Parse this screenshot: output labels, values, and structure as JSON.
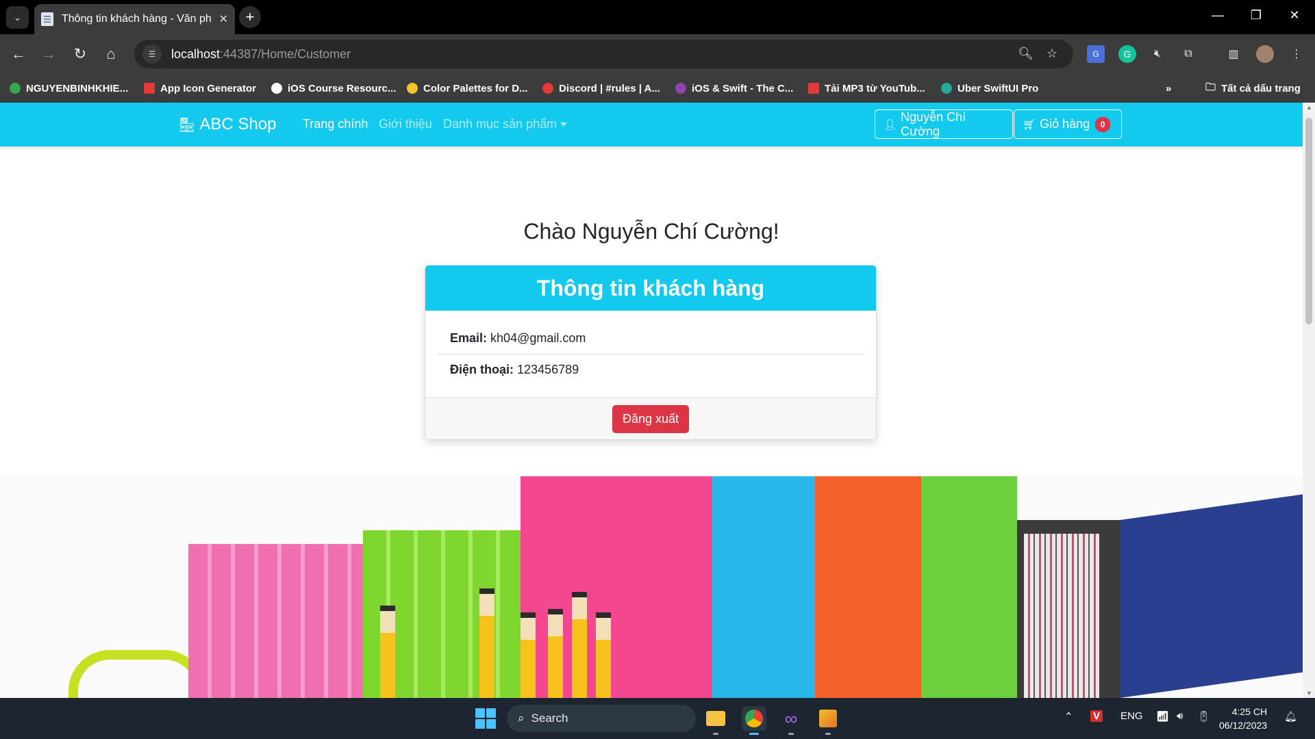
{
  "browser": {
    "tab_title": "Thông tin khách hàng - Văn ph",
    "url_host": "localhost",
    "url_rest": ":44387/Home/Customer",
    "bookmarks": [
      {
        "label": "NGUYENBINHKHIE...",
        "color": "#34a853"
      },
      {
        "label": "App Icon Generator",
        "color": "#e53935"
      },
      {
        "label": "iOS Course Resourc...",
        "color": "#ffffff"
      },
      {
        "label": "Color Palettes for D...",
        "color": "#f4c430"
      },
      {
        "label": "Discord | #rules | A...",
        "color": "#e53935"
      },
      {
        "label": "iOS & Swift - The C...",
        "color": "#8e44ad"
      },
      {
        "label": "Tải MP3 từ YouTub...",
        "color": "#e53935"
      },
      {
        "label": "Uber SwiftUI Pro",
        "color": "#26a69a"
      }
    ],
    "all_bookmarks": "Tất cả dấu trang"
  },
  "navbar": {
    "brand": "ABC Shop",
    "links": [
      "Trang chính",
      "Giới thiệu",
      "Danh mục sản phẩm"
    ],
    "user_button": "Nguyễn Chí Cường",
    "cart_button": "Giỏ hàng",
    "cart_count": "0"
  },
  "main": {
    "greeting": "Chào Nguyễn Chí Cường!",
    "card_title": "Thông tin khách hàng",
    "email_label": "Email:",
    "email_value": "kh04@gmail.com",
    "phone_label": "Điện thoại:",
    "phone_value": "123456789",
    "logout_button": "Đăng xuất"
  },
  "taskbar": {
    "search_placeholder": "Search",
    "language": "ENG",
    "time": "4:25 CH",
    "date": "06/12/2023"
  },
  "colors": {
    "accent": "#13c9ee",
    "danger": "#dc3545"
  }
}
